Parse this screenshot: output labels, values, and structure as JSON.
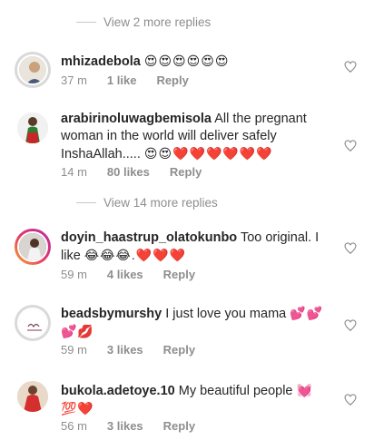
{
  "thread1": {
    "more_replies": "View 2 more replies"
  },
  "thread2": {
    "more_replies": "View 14 more replies"
  },
  "comments": [
    {
      "username": "mhizadebola",
      "text": "",
      "emoji": "😍😍😍😍😍😍",
      "time": "37 m",
      "likes": "1 like",
      "reply": "Reply"
    },
    {
      "username": "arabirinoluwagbemisola",
      "text": "All the pregnant woman in the world will deliver safely InshaAllah.....",
      "emoji": "😍😍❤️❤️❤️❤️❤️❤️",
      "time": "14 m",
      "likes": "80 likes",
      "reply": "Reply"
    },
    {
      "username": "doyin_haastrup_olatokunbo",
      "text": "Too original. I like",
      "emoji": "😂😂😂.❤️❤️❤️",
      "time": "59 m",
      "likes": "4 likes",
      "reply": "Reply"
    },
    {
      "username": "beadsbymurshy",
      "text": "I just love you mama",
      "emoji": "💕💕💕💋",
      "time": "59 m",
      "likes": "3 likes",
      "reply": "Reply"
    },
    {
      "username": "bukola.adetoye.10",
      "text": "My beautiful people",
      "emoji": "💓💯❤️",
      "time": "56 m",
      "likes": "3 likes",
      "reply": "Reply"
    }
  ],
  "icons": {
    "like": "heart-outline-icon"
  },
  "colors": {
    "meta": "#8e8e8e",
    "text": "#262626",
    "story_ring": "#e3346b"
  }
}
